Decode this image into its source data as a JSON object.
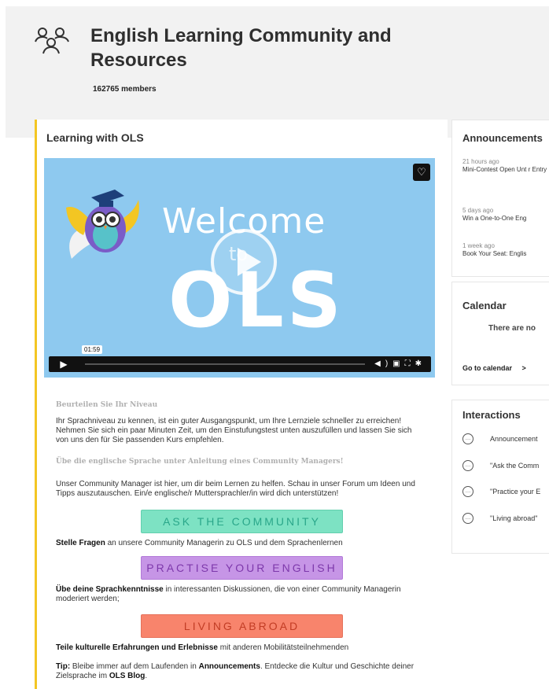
{
  "header": {
    "title": "English Learning Community and Resources",
    "members": "162765 members",
    "icon": "community-icon"
  },
  "main": {
    "card_title": "Learning with OLS",
    "video": {
      "welcome": "Welcome",
      "to": "to",
      "logo_text": "OLS",
      "time": "01:59",
      "icons": [
        "play-icon",
        "volume-icon",
        "captions-icon",
        "fullscreen-icon",
        "settings-icon",
        "heart-icon"
      ]
    },
    "section1_head": "Beurteilen Sie Ihr Niveau",
    "section1_text": "Ihr Sprachniveau zu kennen, ist ein guter Ausgangspunkt, um Ihre Lernziele schneller zu erreichen! Nehmen Sie sich ein paar Minuten Zeit, um den Einstufungstest unten auszufüllen und lassen Sie sich von uns den für Sie passenden Kurs empfehlen.",
    "section2_head": "Übe die englische Sprache unter Anleitung eines Community Managers!",
    "section2_text": "Unser Community Manager ist hier, um dir beim Lernen zu helfen. Schau in unser Forum um Ideen und Tipps auszutauschen. Ein/e englische/r Muttersprachler/in wird dich unterstützen!",
    "ask_label": "ASK THE COMMUNITY",
    "ask_desc_bold": "Stelle Fragen",
    "ask_desc": " an unsere Community Managerin zu OLS und dem Sprachenlernen",
    "practise_label": "PRACTISE YOUR ENGLISH",
    "practise_desc_bold": "Übe deine Sprachkenntnisse",
    "practise_desc": " in interessanten Diskussionen, die von einer Community Managerin moderiert werden;",
    "living_label": "LIVING ABROAD",
    "living_desc_bold": "Teile kulturelle Erfahrungen und Erlebnisse",
    "living_desc": " mit anderen Mobilitätsteilnehmenden",
    "tip_bold": "Tip:",
    "tip_1": " Bleibe immer auf dem Laufenden in ",
    "tip_announcements": "Announcements",
    "tip_2": ". Entdecke die Kultur und Geschichte deiner Zielsprache im ",
    "tip_blog": "OLS Blog",
    "tip_3": "."
  },
  "announcements": {
    "title": "Announcements",
    "items": [
      {
        "time": "21 hours ago",
        "text": "Mini-Contest Open Unt r Entry"
      },
      {
        "time": "5 days ago",
        "text": "Win a One-to-One Eng"
      },
      {
        "time": "1 week ago",
        "text": "Book Your Seat: Englis"
      }
    ]
  },
  "calendar": {
    "title": "Calendar",
    "empty": "There are no",
    "link": "Go to calendar",
    "chevron": ">"
  },
  "interactions": {
    "title": "Interactions",
    "items": [
      "Announcement",
      "\"Ask the Comm",
      "\"Practice your E",
      "\"Living abroad\""
    ]
  }
}
